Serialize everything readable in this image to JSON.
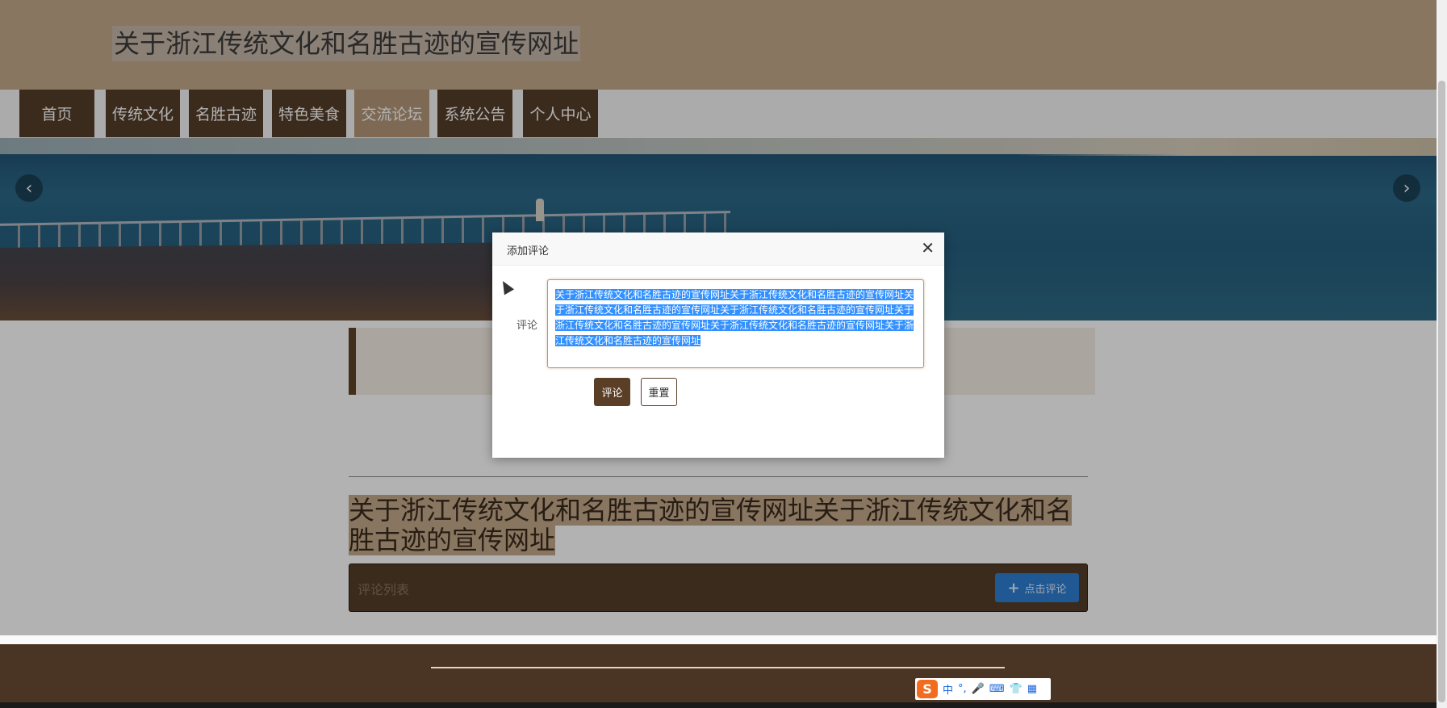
{
  "site": {
    "title": "关于浙江传统文化和名胜古迹的宣传网址"
  },
  "nav": {
    "items": [
      {
        "label": "首页"
      },
      {
        "label": "传统文化"
      },
      {
        "label": "名胜古迹"
      },
      {
        "label": "特色美食"
      },
      {
        "label": "交流论坛",
        "active": true
      },
      {
        "label": "系统公告"
      },
      {
        "label": "个人中心"
      }
    ]
  },
  "banner": {
    "prev_icon": "chevron-left-icon",
    "next_icon": "chevron-right-icon"
  },
  "post": {
    "title": "关于浙江传统文化和名胜古迹的宣传网址关于浙江传统文化和名胜古迹的宣传网址"
  },
  "comments": {
    "list_label": "评论列表",
    "add_button_label": "点击评论",
    "add_button_icon": "plus-icon"
  },
  "modal": {
    "title": "添加评论",
    "close_icon": "close-icon",
    "field_label": "评论",
    "textarea_value": "关于浙江传统文化和名胜古迹的宣传网址关于浙江传统文化和名胜古迹的宣传网址关于浙江传统文化和名胜古迹的宣传网址关于浙江传统文化和名胜古迹的宣传网址关于浙江传统文化和名胜古迹的宣传网址关于浙江传统文化和名胜古迹的宣传网址关于浙江传统文化和名胜古迹的宣传网址",
    "submit_label": "评论",
    "reset_label": "重置"
  },
  "ime": {
    "logo": "S",
    "mode": "中",
    "punct": "°,"
  },
  "colors": {
    "header_bg": "#c3a98b",
    "nav_bg": "#553e2a",
    "nav_active_bg": "#b59779",
    "footer_bg": "#4a3423",
    "primary_button": "#2f7fd4"
  }
}
